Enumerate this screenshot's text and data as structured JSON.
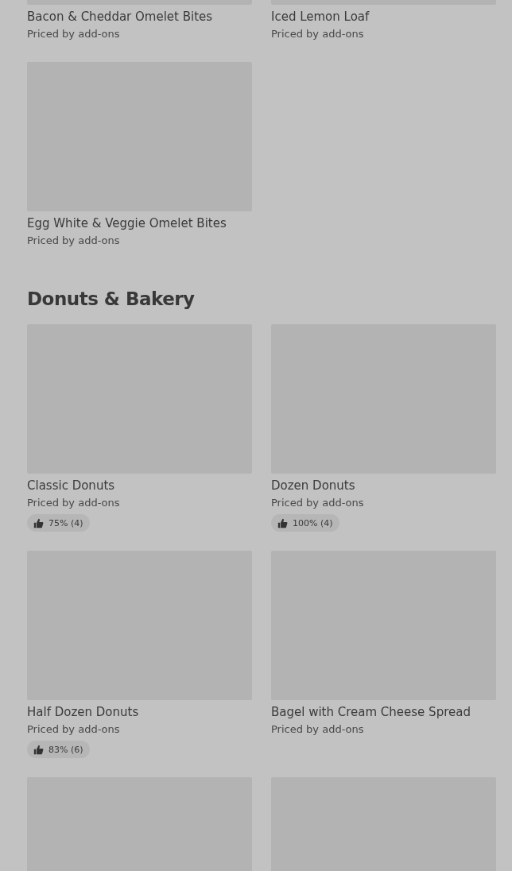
{
  "sections": [
    {
      "items": [
        {
          "kind": "product",
          "name": "Bacon & Cheddar Omelet Bites",
          "price": "Priced by add-ons"
        },
        {
          "kind": "product",
          "name": "Iced Lemon Loaf",
          "price": "Priced by add-ons"
        },
        {
          "kind": "product",
          "name": "Egg White & Veggie Omelet Bites",
          "price": "Priced by add-ons"
        }
      ]
    },
    {
      "title": "Donuts & Bakery",
      "items": [
        {
          "kind": "product",
          "name": "Classic Donuts",
          "price": "Priced by add-ons",
          "rating": "75% (4)"
        },
        {
          "kind": "product",
          "name": "Dozen Donuts",
          "price": "Priced by add-ons",
          "rating": "100% (4)"
        },
        {
          "kind": "product",
          "name": "Half Dozen Donuts",
          "price": "Priced by add-ons",
          "rating": "83% (6)"
        },
        {
          "kind": "product",
          "name": "Bagel with Cream Cheese Spread",
          "price": "Priced by add-ons"
        },
        {
          "kind": "image_only"
        },
        {
          "kind": "image_only"
        }
      ]
    }
  ]
}
